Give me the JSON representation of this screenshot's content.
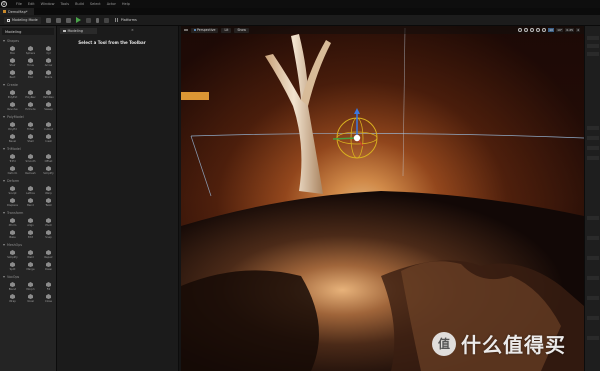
{
  "menu": {
    "logo": "U",
    "items": [
      "File",
      "Edit",
      "Window",
      "Tools",
      "Build",
      "Select",
      "Actor",
      "Help"
    ]
  },
  "level_tab": {
    "label": "DemoMap*"
  },
  "toolbar": {
    "mode_label": "Modeling Mode",
    "platforms_label": "Platforms"
  },
  "palette": {
    "header": "Modeling",
    "sections": [
      {
        "title": "Shapes",
        "tools": [
          "Box",
          "Sphere",
          "Cyl",
          "Stair",
          "Torus",
          "Arrow",
          "Rect",
          "Disc",
          "Stairs"
        ]
      },
      {
        "title": "Create",
        "tools": [
          "PolyExt",
          "PolyRev",
          "PathRev",
          "Revolve",
          "Extrude",
          "Sweep"
        ]
      },
      {
        "title": "PolyModel",
        "tools": [
          "PolyEd",
          "TriSel",
          "Cutout",
          "Bevel",
          "Shell",
          "Inset"
        ]
      },
      {
        "title": "TriModel",
        "tools": [
          "TriEd",
          "Smooth",
          "Offset",
          "Deform",
          "Remesh",
          "Simplify"
        ]
      },
      {
        "title": "Deform",
        "tools": [
          "Sculpt",
          "Lattice",
          "Warp",
          "Displace",
          "Bend",
          "Twist"
        ]
      },
      {
        "title": "Transform",
        "tools": [
          "Xform",
          "Align",
          "Pivot",
          "Bake",
          "Edit",
          "Snap"
        ]
      },
      {
        "title": "MeshOps",
        "tools": [
          "Simplify",
          "Weld",
          "Repair",
          "Split",
          "Merge",
          "Clean"
        ]
      },
      {
        "title": "VoxOps",
        "tools": [
          "Blend",
          "Morph",
          "Fill",
          "Wrap",
          "Voxel",
          "Close"
        ]
      }
    ]
  },
  "details": {
    "tab_label": "Modeling",
    "close": "×",
    "message": "Select a Tool from the Toolbar"
  },
  "viewport": {
    "perspective_label": "Perspective",
    "lit_label": "Lit",
    "show_label": "Show",
    "snap_values": [
      "10",
      "10°",
      "0.25",
      "4"
    ]
  },
  "colors": {
    "accent_orange": "#f0a53a",
    "gizmo_yellow": "#d8b020",
    "gizmo_blue": "#3a78e0",
    "gizmo_green": "#46a040",
    "play_green": "#4aa34a"
  },
  "icons": {
    "logo": "unreal-logo-icon",
    "play": "play-icon",
    "platforms": "platforms-grid-icon",
    "viewport_menu": "hamburger-icon",
    "tool_default": "mesh-tool-icon"
  },
  "watermark": {
    "badge": "值",
    "text": "什么值得买"
  }
}
